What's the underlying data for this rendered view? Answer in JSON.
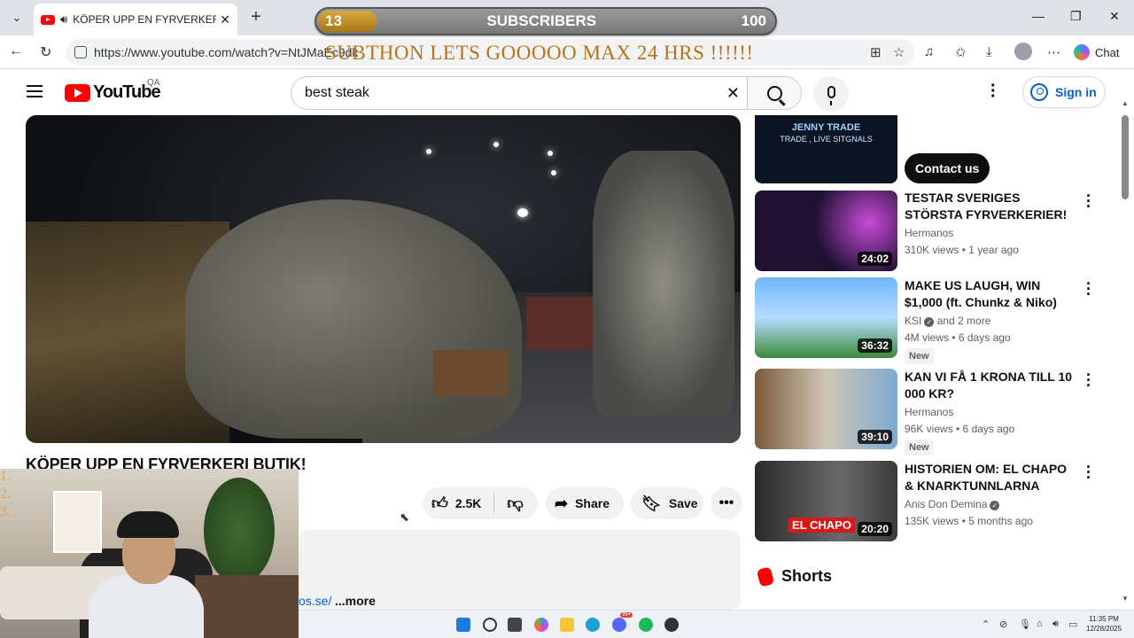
{
  "browser": {
    "tab_title": "KÖPER UPP EN FYRVERKERI B",
    "url": "https://www.youtube.com/watch?v=NtJMaEc9dk",
    "chat_label": "Chat"
  },
  "overlay": {
    "sub_count": "13",
    "sub_label": "SUBSCRIBERS",
    "sub_goal": "100",
    "sub_progress": 0.13,
    "subthon_text": "SUBTHON LETS GOOOOO MAX 24 HRS  !!!!!!",
    "numbered_list": [
      "1.",
      "2.",
      "3."
    ]
  },
  "youtube": {
    "region": "QA",
    "logo_text": "YouTube",
    "search_value": "best steak",
    "signin_label": "Sign in"
  },
  "video": {
    "title": "KÖPER UPP EN FYRVERKERI BUTIK!",
    "likes": "2.5K",
    "share_label": "Share",
    "save_label": "Save",
    "desc_link": "os.se/",
    "more_label": "...more"
  },
  "sidebar": {
    "ad": {
      "brand": "JENNY TRADE",
      "tagline": "TRADE , LIVE SITGNALS",
      "cta": "Contact us"
    },
    "recs": [
      {
        "title": "TESTAR SVERIGES STÖRSTA FYRVERKERIER!",
        "channel": "Hermanos",
        "meta": "310K views • 1 year ago",
        "duration": "24:02",
        "new": ""
      },
      {
        "title": "MAKE US LAUGH, WIN $1,000 (ft. Chunkz & Niko)",
        "channel": "KSI",
        "channel_extra": "and 2 more",
        "meta": "4M views • 6 days ago",
        "duration": "36:32",
        "new": "New"
      },
      {
        "title": "KAN VI FÅ 1 KRONA TILL 10 000 KR?",
        "channel": "Hermanos",
        "meta": "96K views • 6 days ago",
        "duration": "39:10",
        "new": "New"
      },
      {
        "title": "HISTORIEN OM: EL CHAPO & KNARKTUNNLARNA",
        "channel": "Anis Don Demina",
        "meta": "135K views • 5 months ago",
        "duration": "20:20",
        "new": "",
        "thumb_text": "EL CHAPO"
      }
    ],
    "shorts_label": "Shorts"
  },
  "taskbar": {
    "time": "11:35 PM",
    "date": "12/28/2025",
    "discord_badge": "99+"
  },
  "colors": {
    "yt_red": "#ff0000",
    "link_blue": "#065fd4",
    "overlay_gold": "#b8741a"
  }
}
